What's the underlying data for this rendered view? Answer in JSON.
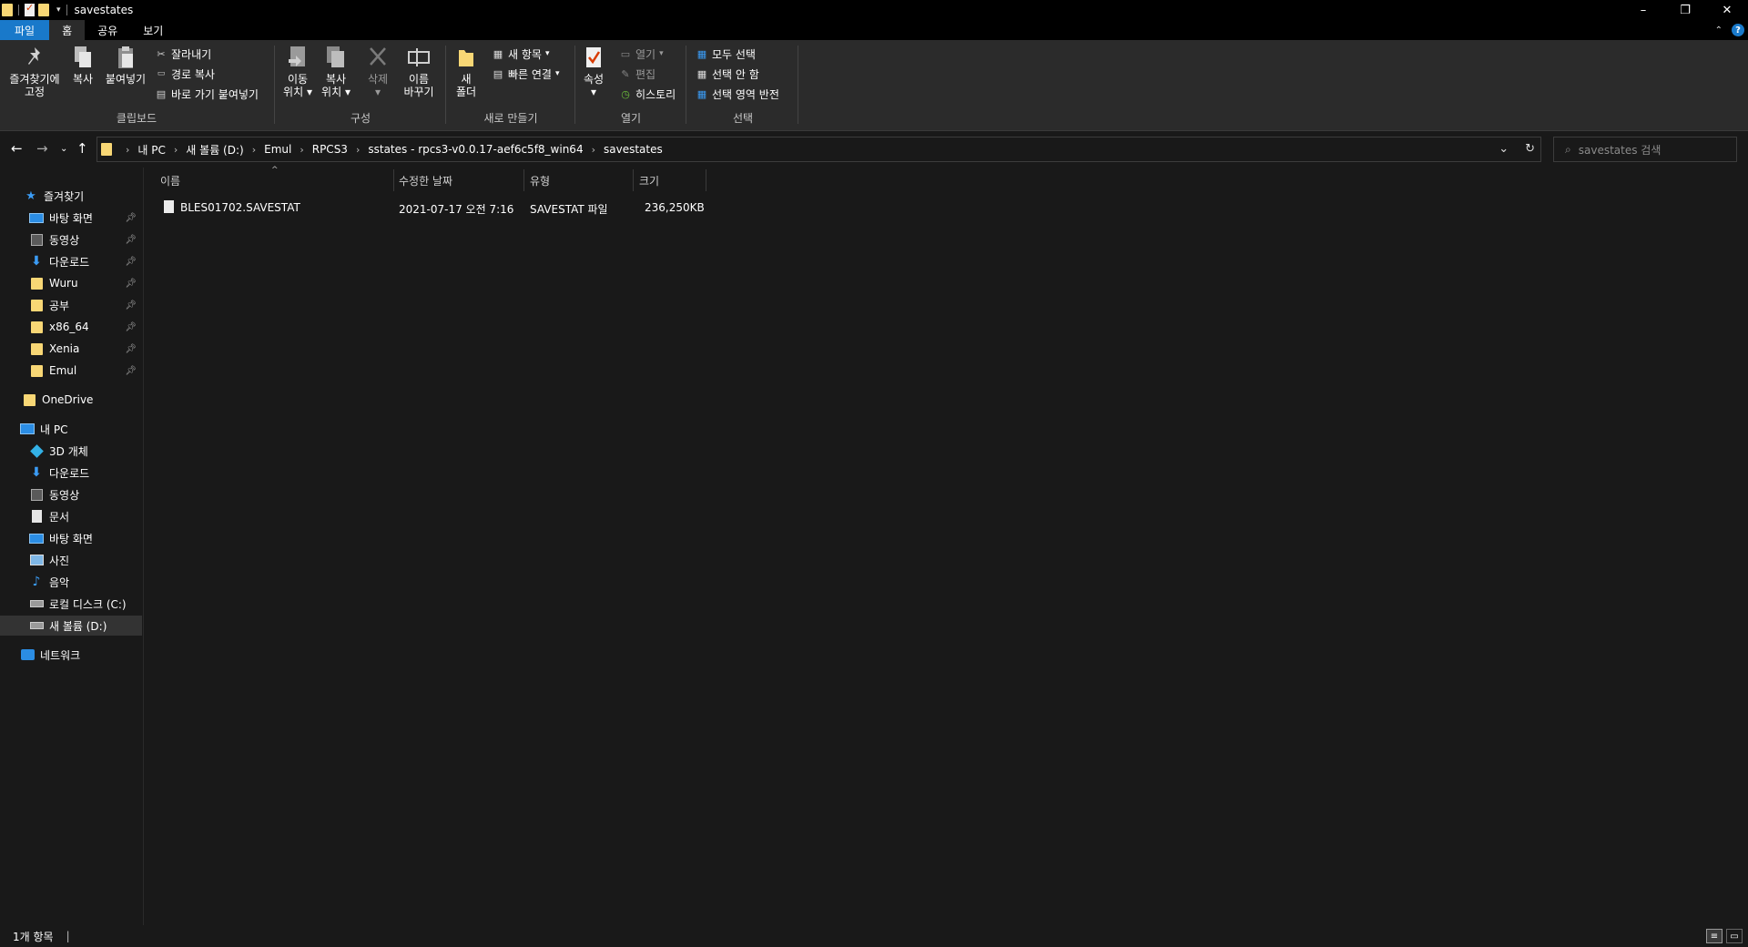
{
  "window": {
    "title": "savestates"
  },
  "tabs": [
    {
      "label": "파일"
    },
    {
      "label": "홈"
    },
    {
      "label": "공유"
    },
    {
      "label": "보기"
    }
  ],
  "ribbon": {
    "clipboard": {
      "group_label": "클립보드",
      "pin_label_1": "즐겨찾기에",
      "pin_label_2": "고정",
      "copy_label": "복사",
      "paste_label": "붙여넣기",
      "cut_label": "잘라내기",
      "copy_path_label": "경로 복사",
      "paste_shortcut_label": "바로 가기 붙여넣기"
    },
    "organize": {
      "group_label": "구성",
      "move_label_1": "이동",
      "move_label_2": "위치",
      "copyto_label_1": "복사",
      "copyto_label_2": "위치",
      "delete_label": "삭제",
      "rename_label_1": "이름",
      "rename_label_2": "바꾸기"
    },
    "new": {
      "group_label": "새로 만들기",
      "new_folder_label_1": "새",
      "new_folder_label_2": "폴더",
      "new_item_label": "새 항목",
      "easy_access_label": "빠른 연결"
    },
    "open": {
      "group_label": "열기",
      "properties_label": "속성",
      "open_label": "열기",
      "edit_label": "편집",
      "history_label": "히스토리"
    },
    "select": {
      "group_label": "선택",
      "select_all_label": "모두 선택",
      "select_none_label": "선택 안 함",
      "invert_label": "선택 영역 반전"
    }
  },
  "address": {
    "crumbs": [
      "내 PC",
      "새 볼륨 (D:)",
      "Emul",
      "RPCS3",
      "sstates - rpcs3-v0.0.17-aef6c5f8_win64",
      "savestates"
    ]
  },
  "search": {
    "placeholder": "savestates 검색"
  },
  "navpane": {
    "quick_access": "즐겨찾기",
    "quick_items": [
      {
        "label": "바탕 화면",
        "icon": "desktop-icon"
      },
      {
        "label": "동영상",
        "icon": "video-icon"
      },
      {
        "label": "다운로드",
        "icon": "download-icon"
      },
      {
        "label": "Wuru",
        "icon": "folder-icon"
      },
      {
        "label": "공부",
        "icon": "folder-icon"
      },
      {
        "label": "x86_64",
        "icon": "folder-icon"
      },
      {
        "label": "Xenia",
        "icon": "folder-icon"
      },
      {
        "label": "Emul",
        "icon": "folder-icon"
      }
    ],
    "onedrive": "OneDrive",
    "this_pc": "내 PC",
    "pc_items": [
      {
        "label": "3D 개체",
        "icon": "3d-objects-icon"
      },
      {
        "label": "다운로드",
        "icon": "download-icon"
      },
      {
        "label": "동영상",
        "icon": "video-icon"
      },
      {
        "label": "문서",
        "icon": "document-icon"
      },
      {
        "label": "바탕 화면",
        "icon": "desktop-icon"
      },
      {
        "label": "사진",
        "icon": "pictures-icon"
      },
      {
        "label": "음악",
        "icon": "music-icon"
      },
      {
        "label": "로컬 디스크 (C:)",
        "icon": "drive-icon"
      },
      {
        "label": "새 볼륨 (D:)",
        "icon": "drive-icon",
        "selected": true
      }
    ],
    "network": "네트워크"
  },
  "filelist": {
    "columns": [
      "이름",
      "수정한 날짜",
      "유형",
      "크기"
    ],
    "rows": [
      {
        "name": "BLES01702.SAVESTAT",
        "date": "2021-07-17 오전 7:16",
        "type": "SAVESTAT 파일",
        "size": "236,250KB"
      }
    ]
  },
  "status": {
    "count": "1개 항목"
  },
  "colors": {
    "accent": "#1979ca",
    "folder": "#f8d775",
    "background": "#191919",
    "ribbon": "#2b2b2b"
  }
}
